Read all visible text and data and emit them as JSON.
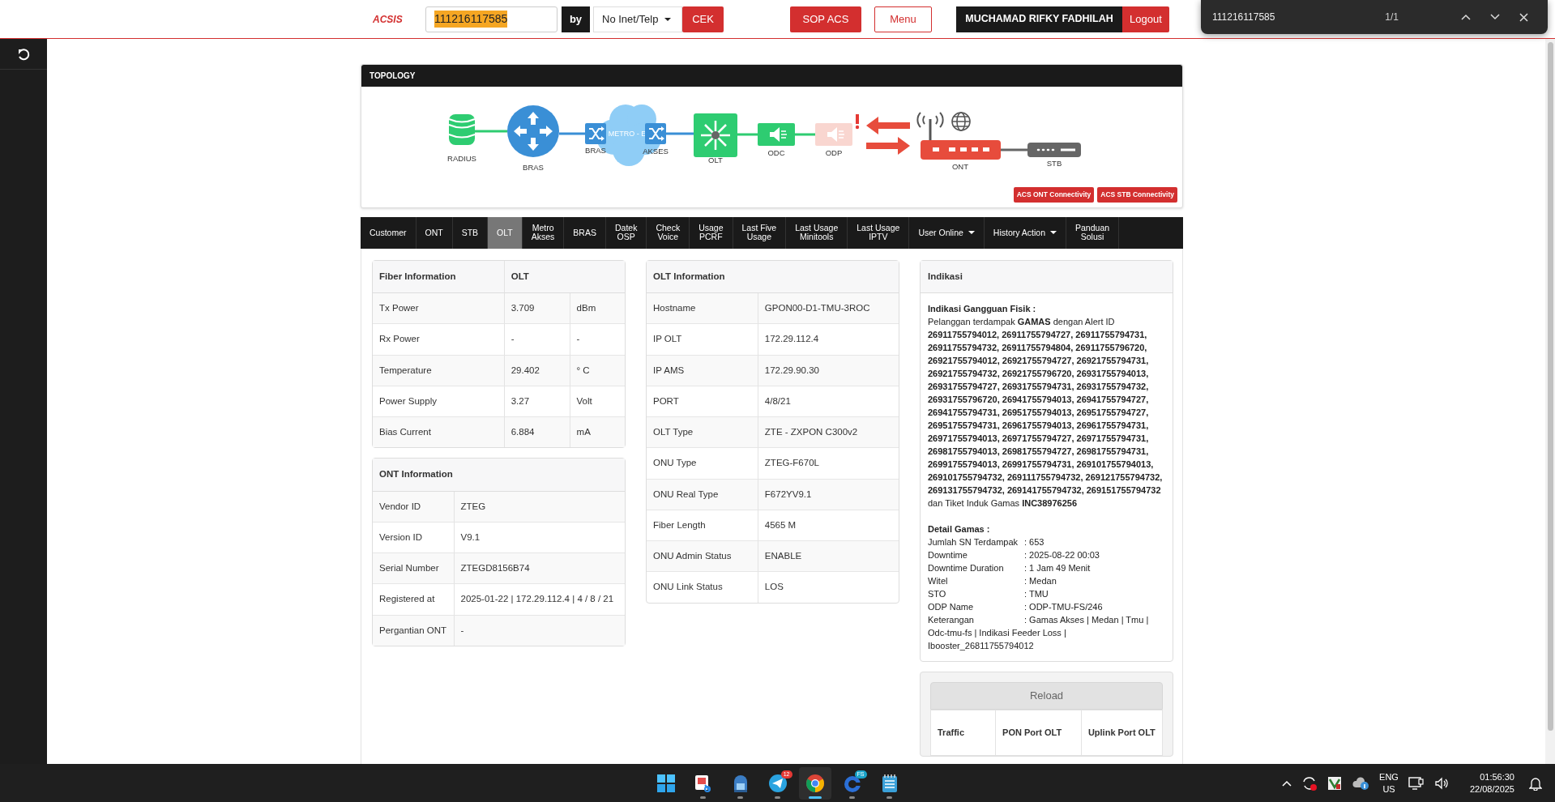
{
  "header": {
    "logo": "ACSIS",
    "search_value": "111216117585",
    "search_highlighted": true,
    "by_label": "by",
    "filter": "No Inet/Telp",
    "check_button": "CEK",
    "sop_button": "SOP ACS",
    "menu_button": "Menu",
    "user_name": "MUCHAMAD RIFKY FADHILAH",
    "logout_button": "Logout"
  },
  "find_bar": {
    "value": "111216117585",
    "count": "1/1"
  },
  "topology": {
    "title": "TOPOLOGY",
    "nodes": [
      {
        "kind": "database",
        "label": "RADIUS",
        "alert": false
      },
      {
        "kind": "router",
        "label": "BRAS",
        "alert": false
      },
      {
        "kind": "switch",
        "label": "BRAS",
        "alert": false
      },
      {
        "kind": "cloud",
        "label": "METRO - E",
        "alert": false
      },
      {
        "kind": "switch",
        "label": "AKSES",
        "alert": false
      },
      {
        "kind": "olt",
        "label": "OLT",
        "alert": false
      },
      {
        "kind": "splitter",
        "label": "ODC",
        "alert": false
      },
      {
        "kind": "splitter",
        "label": "ODP",
        "alert": true
      },
      {
        "kind": "ont",
        "label": "ONT",
        "alert": false
      },
      {
        "kind": "stb",
        "label": "STB",
        "alert": false
      }
    ],
    "buttons": [
      "ACS ONT Connectivity",
      "ACS STB Connectivity"
    ]
  },
  "tabs": [
    {
      "lines": [
        "Customer"
      ],
      "selected": false,
      "dropdown": false
    },
    {
      "lines": [
        "ONT"
      ],
      "selected": false,
      "dropdown": false
    },
    {
      "lines": [
        "STB"
      ],
      "selected": false,
      "dropdown": false
    },
    {
      "lines": [
        "OLT"
      ],
      "selected": true,
      "dropdown": false
    },
    {
      "lines": [
        "Metro",
        "Akses"
      ],
      "selected": false,
      "dropdown": false
    },
    {
      "lines": [
        "BRAS"
      ],
      "selected": false,
      "dropdown": false
    },
    {
      "lines": [
        "Datek",
        "OSP"
      ],
      "selected": false,
      "dropdown": false
    },
    {
      "lines": [
        "Check",
        "Voice"
      ],
      "selected": false,
      "dropdown": false
    },
    {
      "lines": [
        "Usage",
        "PCRF"
      ],
      "selected": false,
      "dropdown": false
    },
    {
      "lines": [
        "Last Five",
        "Usage"
      ],
      "selected": false,
      "dropdown": false
    },
    {
      "lines": [
        "Last Usage",
        "Minitools"
      ],
      "selected": false,
      "dropdown": false
    },
    {
      "lines": [
        "Last Usage",
        "IPTV"
      ],
      "selected": false,
      "dropdown": false
    },
    {
      "lines": [
        "User Online"
      ],
      "selected": false,
      "dropdown": true
    },
    {
      "lines": [
        "History Action"
      ],
      "selected": false,
      "dropdown": true
    },
    {
      "lines": [
        "Panduan",
        "Solusi"
      ],
      "selected": false,
      "dropdown": false
    }
  ],
  "fiber_information": {
    "title": "Fiber Information",
    "source": "OLT",
    "readings": [
      {
        "label": "Tx Power",
        "value": "3.709",
        "unit": "dBm"
      },
      {
        "label": "Rx Power",
        "value": "-",
        "unit": "-"
      },
      {
        "label": "Temperature",
        "value": "29.402",
        "unit": "° C"
      },
      {
        "label": "Power Supply",
        "value": "3.27",
        "unit": "Volt"
      },
      {
        "label": "Bias Current",
        "value": "6.884",
        "unit": "mA"
      }
    ]
  },
  "ont_information": {
    "title": "ONT Information",
    "rows": [
      [
        "Vendor ID",
        "ZTEG"
      ],
      [
        "Version ID",
        "V9.1"
      ],
      [
        "Serial Number",
        "ZTEGD8156B74"
      ],
      [
        "Registered at",
        "2025-01-22 | 172.29.112.4 | 4 / 8 / 21"
      ],
      [
        "Pergantian ONT",
        "-"
      ]
    ]
  },
  "olt_information": {
    "title": "OLT Information",
    "rows": [
      [
        "Hostname",
        "GPON00-D1-TMU-3ROC"
      ],
      [
        "IP OLT",
        "172.29.112.4"
      ],
      [
        "IP AMS",
        "172.29.90.30"
      ],
      [
        "PORT",
        "4/8/21"
      ],
      [
        "OLT Type",
        "ZTE - ZXPON C300v2"
      ],
      [
        "ONU Type",
        "ZTEG-F670L"
      ],
      [
        "ONU Real Type",
        "F672YV9.1"
      ],
      [
        "Fiber Length",
        "4565 M"
      ],
      [
        "ONU Admin Status",
        "ENABLE"
      ],
      [
        "ONU Link Status",
        "LOS"
      ]
    ]
  },
  "indikasi": {
    "title": "Indikasi",
    "heading": "Indikasi Gangguan Fisik :",
    "text": "Pelanggan terdampak **GAMAS** dengan Alert ID **26911755794012, 26911755794727, 26911755794731, 26911755794732, 26911755794804, 26911755796720, 26921755794012, 26921755794727, 26921755794731, 26921755794732, 26921755796720, 26931755794013, 26931755794727, 26931755794731, 26931755794732, 26931755796720, 26941755794013, 26941755794727, 26941755794731, 26951755794013, 26951755794727, 26951755794731, 26961755794013, 26961755794731, 26971755794013, 26971755794727, 26971755794731, 26981755794013, 26981755794727, 26981755794731, 26991755794013, 26991755794731, 269101755794013, 269101755794732, 269111755794732, 269121755794732, 269131755794732, 269141755794732, 269151755794732** dan Tiket Induk Gamas **INC38976256**",
    "detail_heading": "Detail Gamas :",
    "details": [
      {
        "label": "Jumlah SN Terdampak",
        "value": ": 653"
      },
      {
        "label": "Downtime",
        "value": ": 2025-08-22 00:03"
      },
      {
        "label": "Downtime Duration",
        "value": ": 1 Jam 49 Menit"
      },
      {
        "label": "Witel",
        "value": ": Medan"
      },
      {
        "label": "STO",
        "value": ": TMU"
      },
      {
        "label": "ODP Name",
        "value": ": ODP-TMU-FS/246"
      },
      {
        "label": "Keterangan",
        "value": ": Gamas Akses | Medan | Tmu | Odc-tmu-fs | Indikasi Feeder Loss | Ibooster_26811755794012"
      }
    ]
  },
  "traffic": {
    "button": "Reload",
    "columns": [
      "Traffic",
      "PON Port OLT",
      "Uplink Port OLT"
    ]
  },
  "taskbar": {
    "apps": [
      {
        "kind": "start",
        "running": false,
        "selected": false
      },
      {
        "kind": "snipping",
        "running": true,
        "selected": false
      },
      {
        "kind": "vpn",
        "running": true,
        "selected": false
      },
      {
        "kind": "telegram",
        "running": true,
        "selected": false,
        "badge": "12"
      },
      {
        "kind": "chrome",
        "running": true,
        "selected": true
      },
      {
        "kind": "fs",
        "running": true,
        "selected": false,
        "badge": "FS"
      },
      {
        "kind": "notepad",
        "running": true,
        "selected": false
      }
    ],
    "tray": {
      "language": "ENG",
      "region": "US",
      "time": "01:56:30",
      "date": "22/08/2025"
    }
  }
}
